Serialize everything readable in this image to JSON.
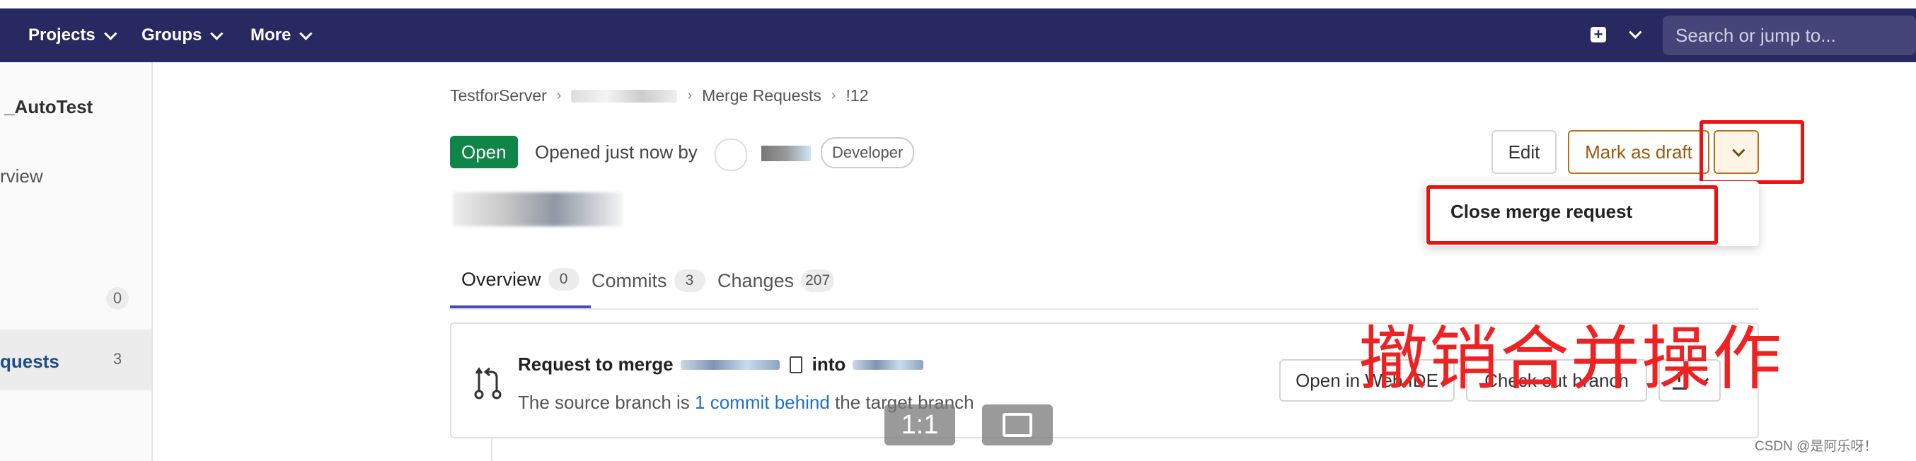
{
  "navbar": {
    "items": [
      "Projects",
      "Groups",
      "More"
    ],
    "search_placeholder": "Search or jump to..."
  },
  "sidebar": {
    "project_title": "_AutoTest",
    "overview": "rview",
    "issues_count": "0",
    "merge_requests": "quests",
    "merge_requests_count": "3"
  },
  "breadcrumb": {
    "root": "TestforServer",
    "section": "Merge Requests",
    "current": "!12"
  },
  "status": {
    "badge": "Open",
    "opened_text": "Opened just now by",
    "role": "Developer"
  },
  "actions": {
    "edit": "Edit",
    "mark_draft": "Mark as draft",
    "close_mr": "Close merge request"
  },
  "tabs": [
    {
      "label": "Overview",
      "count": "0"
    },
    {
      "label": "Commits",
      "count": "3"
    },
    {
      "label": "Changes",
      "count": "207"
    }
  ],
  "widget": {
    "request_to_merge": "Request to merge",
    "into": "into",
    "sub_prefix": "The source branch is",
    "sub_link": "1 commit behind",
    "sub_suffix": "the target branch",
    "open_web_ide": "Open in Web IDE",
    "checkout_branch": "Check out branch"
  },
  "annotation": "撤销合并操作",
  "viewer": {
    "one_to_one": "1:1"
  },
  "watermark": "CSDN @是阿乐呀！",
  "colors": {
    "navbar_bg": "#292961",
    "open_badge": "#108548",
    "draft_accent": "#b86e18",
    "annotation_red": "#ee2222"
  }
}
